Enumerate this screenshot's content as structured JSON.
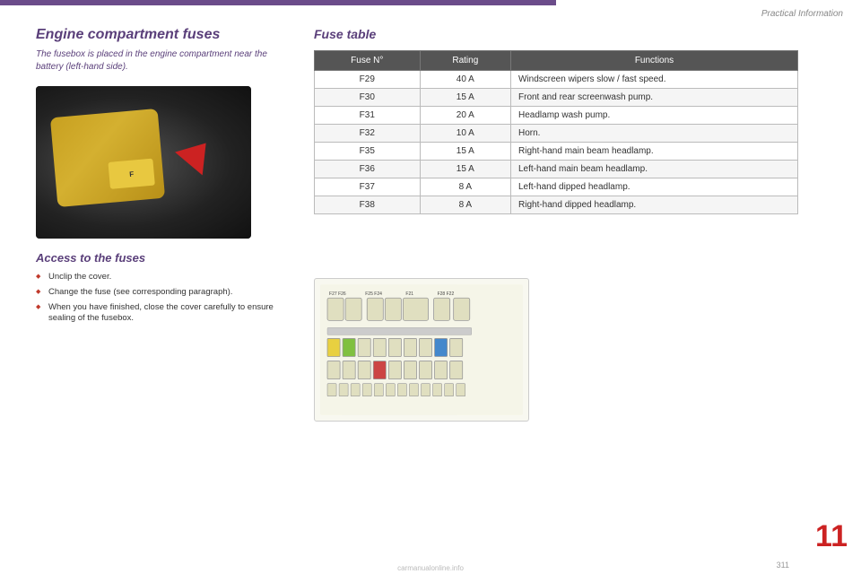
{
  "header": {
    "title": "Practical Information"
  },
  "left": {
    "section_title": "Engine compartment fuses",
    "section_subtitle": "The fusebox is placed in the engine compartment near the battery (left-hand side).",
    "access_title": "Access to the fuses",
    "access_items": [
      "Unclip the cover.",
      "Change the fuse (see corresponding paragraph).",
      "When you have finished, close the cover carefully to ensure sealing of the fusebox."
    ]
  },
  "right": {
    "fuse_table_title": "Fuse table",
    "table_headers": [
      "Fuse N°",
      "Rating",
      "Functions"
    ],
    "table_rows": [
      {
        "fuse": "F29",
        "rating": "40 A",
        "function": "Windscreen wipers slow / fast speed."
      },
      {
        "fuse": "F30",
        "rating": "15 A",
        "function": "Front and rear screenwash pump."
      },
      {
        "fuse": "F31",
        "rating": "20 A",
        "function": "Headlamp wash pump."
      },
      {
        "fuse": "F32",
        "rating": "10 A",
        "function": "Horn."
      },
      {
        "fuse": "F35",
        "rating": "15 A",
        "function": "Right-hand main beam headlamp."
      },
      {
        "fuse": "F36",
        "rating": "15 A",
        "function": "Left-hand main beam headlamp."
      },
      {
        "fuse": "F37",
        "rating": "8 A",
        "function": "Left-hand dipped headlamp."
      },
      {
        "fuse": "F38",
        "rating": "8 A",
        "function": "Right-hand dipped headlamp."
      }
    ]
  },
  "page": {
    "number": "11",
    "bottom_number": "311"
  },
  "site": "carmanualonline.info"
}
